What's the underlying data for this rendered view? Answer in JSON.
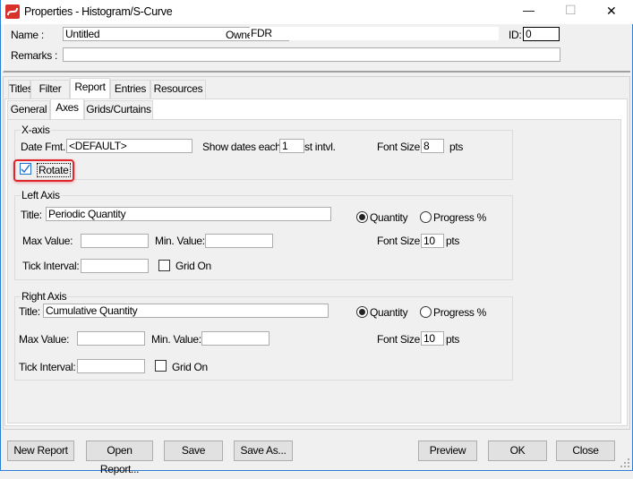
{
  "window": {
    "title": "Properties - Histogram/S-Curve",
    "minimize": "—",
    "maximize": "☐",
    "close": "✕"
  },
  "header": {
    "name_label": "Name :",
    "name_value": "Untitled",
    "owner_label": "Owner:",
    "owner_value": "FDR",
    "id_label": "ID:",
    "id_value": "0",
    "remarks_label": "Remarks :",
    "remarks_value": ""
  },
  "tabs": [
    "Titles",
    "Filter",
    "Report",
    "Entries",
    "Resources"
  ],
  "active_tab": "Report",
  "subtabs": [
    "General",
    "Axes",
    "Grids/Curtains"
  ],
  "active_subtab": "Axes",
  "xaxis": {
    "legend": "X-axis",
    "date_fmt_label": "Date Fmt.:",
    "date_fmt_value": "<DEFAULT>",
    "show_dates_label": "Show dates each",
    "show_dates_value": "1",
    "intvl_label": "st intvl.",
    "font_size_label": "Font Size:",
    "font_size_value": "8",
    "pts": "pts",
    "rotate_label": "Rotate",
    "rotate_checked": true,
    "highlight_color": "#e0262b"
  },
  "left_axis": {
    "legend": "Left Axis",
    "title_label": "Title:",
    "title_value": "Periodic Quantity",
    "quantity_label": "Quantity",
    "progress_label": "Progress %",
    "selected": "Quantity",
    "max_label": "Max Value:",
    "max_value": "",
    "min_label": "Min. Value:",
    "min_value": "",
    "font_size_label": "Font Size:",
    "font_size_value": "10",
    "pts": "pts",
    "tick_label": "Tick Interval:",
    "tick_value": "",
    "grid_label": "Grid On",
    "grid_checked": false
  },
  "right_axis": {
    "legend": "Right Axis",
    "title_label": "Title:",
    "title_value": "Cumulative Quantity",
    "quantity_label": "Quantity",
    "progress_label": "Progress %",
    "selected": "Quantity",
    "max_label": "Max Value:",
    "max_value": "",
    "min_label": "Min. Value:",
    "min_value": "",
    "font_size_label": "Font Size:",
    "font_size_value": "10",
    "pts": "pts",
    "tick_label": "Tick Interval:",
    "tick_value": "",
    "grid_label": "Grid On",
    "grid_checked": false
  },
  "buttons": {
    "new_report": "New Report",
    "open_report": "Open Report...",
    "save": "Save",
    "save_as": "Save As...",
    "preview": "Preview",
    "ok": "OK",
    "close": "Close"
  }
}
